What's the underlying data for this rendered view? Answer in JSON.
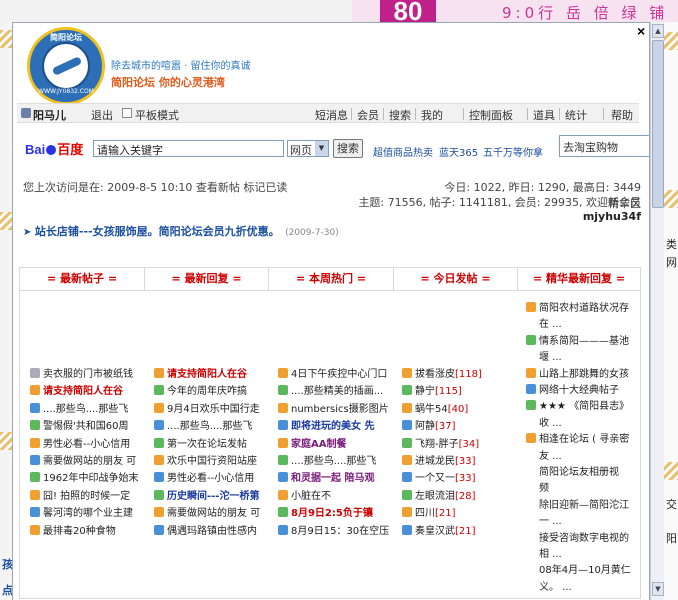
{
  "background": {
    "banner_number": "80",
    "banner_text": "9:0行 岳 倍 绿 铺",
    "right_labels": [
      "类",
      "网",
      "交",
      "阳"
    ],
    "left_labels": [
      "孩",
      "点"
    ]
  },
  "popup": {
    "close_label": "×",
    "logo": {
      "top_text": "简阳论坛",
      "bottom_text": "WWW.JY0832.COM"
    },
    "slogan1": "除去城市的喧嚣 · 留住你的真诚",
    "slogan2": "简阳论坛  你的心灵港湾",
    "toolbar": {
      "username": "阳马儿",
      "logout": "退出",
      "plain_mode": "平板模式",
      "menus": [
        "短消息",
        "会员",
        "搜索",
        "我的",
        "控制面板",
        "道具",
        "统计",
        "帮助"
      ]
    },
    "search": {
      "logo_bai": "Bai",
      "logo_du": "百度",
      "query": "请输入关键字",
      "type": "网页",
      "button": "搜索",
      "hot_links": [
        "超值商品热卖",
        "蓝天365",
        "五千万等你拿"
      ],
      "taobao_query": "去淘宝购物"
    },
    "visit_info": "您上次访问是在: 2009-8-5 10:10 查看新帖 标记已读",
    "stats1": "今日: 1022, 昨日: 1290, 最高日: 3449  精华区",
    "stats2_prefix": "主题: 71556, 帖子: 1141181, 会员: 29935, 欢迎新会员 ",
    "stats2_member": "mjyhu34f",
    "announcement": {
      "bullet": "➤",
      "text": "站长店铺---女孩服饰屋。简阳论坛会员九折优惠。",
      "date": "(2009-7-30)"
    },
    "tabs": [
      "= 最新帖子 =",
      "= 最新回复 =",
      "= 本周热门 =",
      "= 今日发帖 =",
      "= 精华最新回复 ="
    ],
    "columns": {
      "col1": [
        {
          "text": "卖衣服的门市被纸钱",
          "icon": "gray",
          "style": ""
        },
        {
          "text": "请支持简阳人在谷",
          "icon": "orange",
          "style": "red"
        },
        {
          "text": "....那些鸟....那些飞",
          "icon": "blue",
          "style": ""
        },
        {
          "text": "警惕假'共和国60周",
          "icon": "green",
          "style": ""
        },
        {
          "text": "男性必看--小心信用",
          "icon": "orange",
          "style": ""
        },
        {
          "text": "需要做网站的朋友 可",
          "icon": "blue",
          "style": ""
        },
        {
          "text": "1962年中印战争始末",
          "icon": "green",
          "style": ""
        },
        {
          "text": "囧! 拍照的时候一定",
          "icon": "orange",
          "style": ""
        },
        {
          "text": "馨河湾的哪个业主建",
          "icon": "blue",
          "style": ""
        },
        {
          "text": "最排毒20种食物",
          "icon": "orange",
          "style": ""
        }
      ],
      "col2": [
        {
          "text": "请支持简阳人在谷",
          "icon": "orange",
          "style": "red"
        },
        {
          "text": "今年的周年庆咋搞",
          "icon": "green",
          "style": ""
        },
        {
          "text": "9月4日欢乐中国行走",
          "icon": "orange",
          "style": ""
        },
        {
          "text": "....那些鸟....那些飞",
          "icon": "blue",
          "style": ""
        },
        {
          "text": "第一次在论坛发帖",
          "icon": "green",
          "style": ""
        },
        {
          "text": "欢乐中国行资阳站座",
          "icon": "orange",
          "style": ""
        },
        {
          "text": "男性必看--小心信用",
          "icon": "blue",
          "style": ""
        },
        {
          "text": "历史瞬间---沱一桥第",
          "icon": "green",
          "style": "blue"
        },
        {
          "text": "需要做网站的朋友 可",
          "icon": "orange",
          "style": ""
        },
        {
          "text": "偶遇玛路镇由性感内",
          "icon": "blue",
          "style": ""
        }
      ],
      "col3": [
        {
          "text": "4日下午疾控中心门口",
          "icon": "orange",
          "style": ""
        },
        {
          "text": "....那些精美的插画...",
          "icon": "green",
          "style": ""
        },
        {
          "text": "numbersics摄影图片",
          "icon": "orange",
          "style": ""
        },
        {
          "text": "即将进玩的美女 先",
          "icon": "blue",
          "style": "blue"
        },
        {
          "text": "家庭AA制餐",
          "icon": "orange",
          "style": "purple"
        },
        {
          "text": "....那些鸟....那些飞",
          "icon": "green",
          "style": ""
        },
        {
          "text": "和灵据一起 陪马观",
          "icon": "blue",
          "style": "purple"
        },
        {
          "text": "小脏在不",
          "icon": "orange",
          "style": ""
        },
        {
          "text": "8月9日2:5负于镶",
          "icon": "green",
          "style": "red"
        },
        {
          "text": "8月9日15：30在空压",
          "icon": "blue",
          "style": ""
        }
      ],
      "col4": [
        {
          "text": "拔看涨皮",
          "count": "[118]",
          "icon": "orange"
        },
        {
          "text": "静宁",
          "count": "[115]",
          "icon": "green"
        },
        {
          "text": "蜗牛54",
          "count": "[40]",
          "icon": "orange"
        },
        {
          "text": "阿静",
          "count": "[37]",
          "icon": "blue"
        },
        {
          "text": "飞翔-胖子",
          "count": "[34]",
          "icon": "green"
        },
        {
          "text": "进城龙民",
          "count": "[33]",
          "icon": "orange"
        },
        {
          "text": "一个又一",
          "count": "[33]",
          "icon": "blue"
        },
        {
          "text": "左眼流泪",
          "count": "[28]",
          "icon": "green"
        },
        {
          "text": "四川",
          "count": "[21]",
          "icon": "orange"
        },
        {
          "text": "奏皇汉武",
          "count": "[21]",
          "icon": "blue"
        }
      ],
      "col5": [
        {
          "text": "简阳农村道路状况存",
          "icon": "orange"
        },
        {
          "text": "在 ...",
          "icon": "none"
        },
        {
          "text": "情系简阳———基池",
          "icon": "green"
        },
        {
          "text": "堰 ...",
          "icon": "none"
        },
        {
          "text": "山路上那跳舞的女孩",
          "icon": "orange"
        },
        {
          "text": "网络十大经典帖子",
          "icon": "blue"
        },
        {
          "text": "★★★ 《简阳县志》",
          "icon": "green"
        },
        {
          "text": "收 ...",
          "icon": "none"
        },
        {
          "text": "相逢在论坛 ( 寻亲密",
          "icon": "orange"
        },
        {
          "text": "友 ...",
          "icon": "none"
        },
        {
          "text": "简阳论坛友相册视",
          "icon": "none"
        },
        {
          "text": "频",
          "icon": "none"
        },
        {
          "text": "除旧迎新—简阳沱江",
          "icon": "none"
        },
        {
          "text": "一 ...",
          "icon": "none"
        },
        {
          "text": "接受咨询数字电视的",
          "icon": "none"
        },
        {
          "text": "相 ...",
          "icon": "none"
        },
        {
          "text": "08年4月—10月黄仁",
          "icon": "none"
        },
        {
          "text": "义。 ...",
          "icon": "none"
        }
      ]
    }
  }
}
